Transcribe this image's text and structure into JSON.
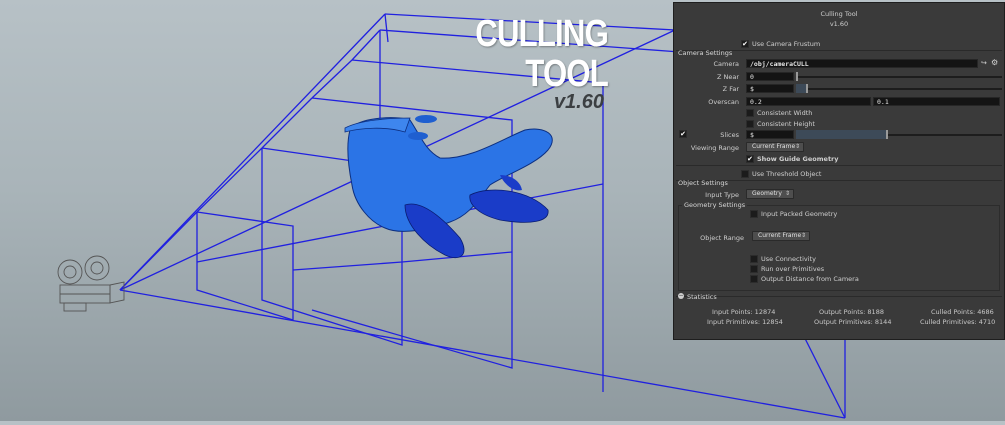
{
  "viewport": {
    "overlay_title": "CULLING TOOL",
    "overlay_version": "v1.60",
    "frustum_color": "#2020e0",
    "mesh_color": "#2a74e8"
  },
  "panel": {
    "title": "Culling Tool",
    "version": "v1.60",
    "use_camera_frustum": {
      "label": "Use Camera Frustum",
      "checked": true
    },
    "camera_settings": {
      "header": "Camera Settings",
      "camera_label": "Camera",
      "camera_value": "/obj/cameraCULL",
      "z_near_label": "Z Near",
      "z_near_value": "0",
      "z_far_label": "Z Far",
      "z_far_value": "$",
      "overscan_label": "Overscan",
      "overscan_x": "0.2",
      "overscan_y": "0.1",
      "consistent_width": {
        "label": "Consistent Width",
        "checked": false
      },
      "consistent_height": {
        "label": "Consistent Height",
        "checked": false
      },
      "slices_label": "Slices",
      "slices_value": "$",
      "viewing_range_label": "Viewing Range",
      "viewing_range_value": "Current Frame",
      "show_guide_geometry": {
        "label": "Show Guide Geometry",
        "checked": true
      }
    },
    "use_threshold_object": {
      "label": "Use Threshold Object",
      "checked": false
    },
    "object_settings": {
      "header": "Object Settings",
      "input_type_label": "Input Type",
      "input_type_value": "Geometry",
      "geometry_settings_header": "Geometry Settings",
      "input_packed_geometry": {
        "label": "Input Packed Geometry",
        "checked": false
      },
      "object_range_label": "Object Range",
      "object_range_value": "Current Frame",
      "use_connectivity": {
        "label": "Use Connectivity",
        "checked": false
      },
      "run_over_primitives": {
        "label": "Run over Primitives",
        "checked": false
      },
      "output_distance": {
        "label": "Output Distance from Camera",
        "checked": false
      }
    },
    "statistics": {
      "header": "Statistics",
      "input_points": "Input Points: 12874",
      "output_points": "Output Points: 8188",
      "culled_points": "Culled Points: 4686",
      "input_primitives": "Input Primitives: 12854",
      "output_primitives": "Output Primitives: 8144",
      "culled_primitives": "Culled Primitives: 4710"
    }
  }
}
